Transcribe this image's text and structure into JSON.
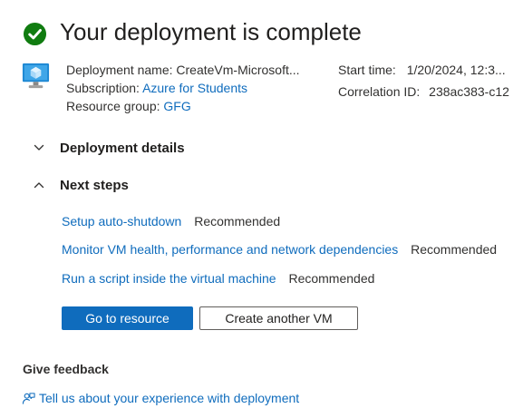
{
  "header": {
    "title": "Your deployment is complete",
    "success_color": "#107c10",
    "success_icon": "checkmark-circle-icon"
  },
  "resource": {
    "icon": "virtual-machine-icon",
    "deployment_name_label": "Deployment name:",
    "deployment_name_value": "CreateVm-Microsoft...",
    "subscription_label": "Subscription:",
    "subscription_value": "Azure for Students",
    "resource_group_label": "Resource group:",
    "resource_group_value": "GFG",
    "start_time_label": "Start time:",
    "start_time_value": "1/20/2024, 12:3...",
    "correlation_id_label": "Correlation ID:",
    "correlation_id_value": "238ac383-c12"
  },
  "sections": {
    "deployment_details": {
      "title": "Deployment details",
      "expanded": false
    },
    "next_steps": {
      "title": "Next steps",
      "expanded": true,
      "items": [
        {
          "link": "Setup auto-shutdown",
          "badge": "Recommended"
        },
        {
          "link": "Monitor VM health, performance and network dependencies",
          "badge": "Recommended"
        },
        {
          "link": "Run a script inside the virtual machine",
          "badge": "Recommended"
        }
      ]
    }
  },
  "actions": {
    "primary_label": "Go to resource",
    "secondary_label": "Create another VM"
  },
  "feedback": {
    "title": "Give feedback",
    "link_label": "Tell us about your experience with deployment",
    "icon": "feedback-person-icon"
  },
  "colors": {
    "accent": "#0f6cbd",
    "success": "#107c10"
  }
}
